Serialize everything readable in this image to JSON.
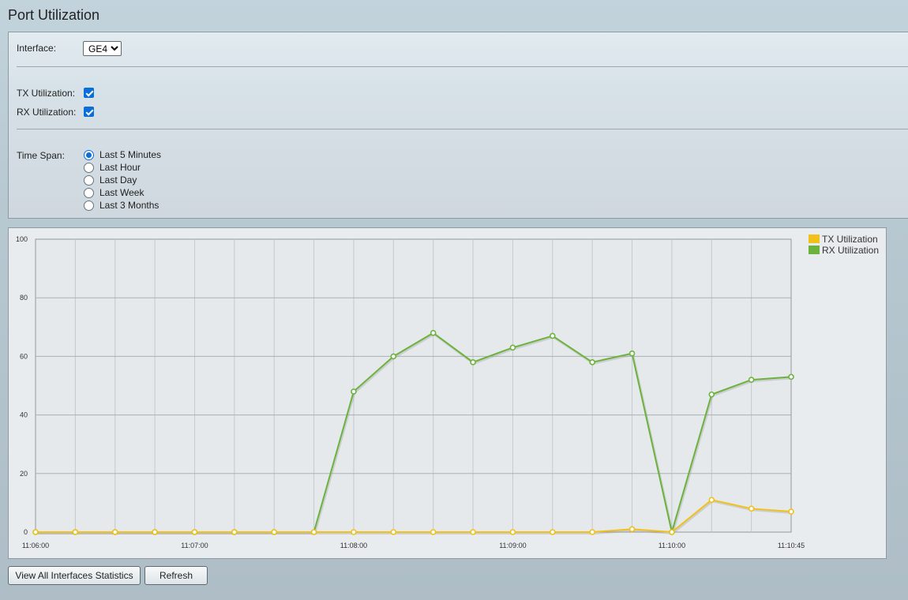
{
  "page": {
    "title": "Port Utilization"
  },
  "form": {
    "interface_label": "Interface:",
    "interface_value": "GE4",
    "tx_label": "TX Utilization:",
    "tx_checked": true,
    "rx_label": "RX Utilization:",
    "rx_checked": true,
    "timespan_label": "Time Span:",
    "timespan_options": [
      "Last 5 Minutes",
      "Last Hour",
      "Last Day",
      "Last Week",
      "Last 3 Months"
    ],
    "timespan_selected": 0
  },
  "chart_data": {
    "type": "line",
    "x_times": [
      "11:06:00",
      "11:06:15",
      "11:06:30",
      "11:06:45",
      "11:07:00",
      "11:07:15",
      "11:07:30",
      "11:07:45",
      "11:08:00",
      "11:08:15",
      "11:08:30",
      "11:08:45",
      "11:09:00",
      "11:09:15",
      "11:09:30",
      "11:09:45",
      "11:10:00",
      "11:10:15",
      "11:10:30",
      "11:10:45"
    ],
    "x_tick_labels": [
      "11:06:00",
      "11:07:00",
      "11:08:00",
      "11:09:00",
      "11:10:00",
      "11:10:45"
    ],
    "ylim": [
      0,
      100
    ],
    "y_ticks": [
      0,
      20,
      40,
      60,
      80,
      100
    ],
    "grid": true,
    "legend_position": "top-right",
    "series": [
      {
        "name": "TX Utilization",
        "color": "#f2c01b",
        "values": [
          0,
          0,
          0,
          0,
          0,
          0,
          0,
          0,
          0,
          0,
          0,
          0,
          0,
          0,
          0,
          1,
          0,
          11,
          8,
          7
        ]
      },
      {
        "name": "RX Utilization",
        "color": "#6cb33e",
        "values": [
          0,
          0,
          0,
          0,
          0,
          0,
          0,
          0,
          48,
          60,
          68,
          58,
          63,
          67,
          58,
          61,
          0,
          47,
          52,
          53
        ]
      }
    ]
  },
  "buttons": {
    "view_all": "View All Interfaces Statistics",
    "refresh": "Refresh"
  }
}
